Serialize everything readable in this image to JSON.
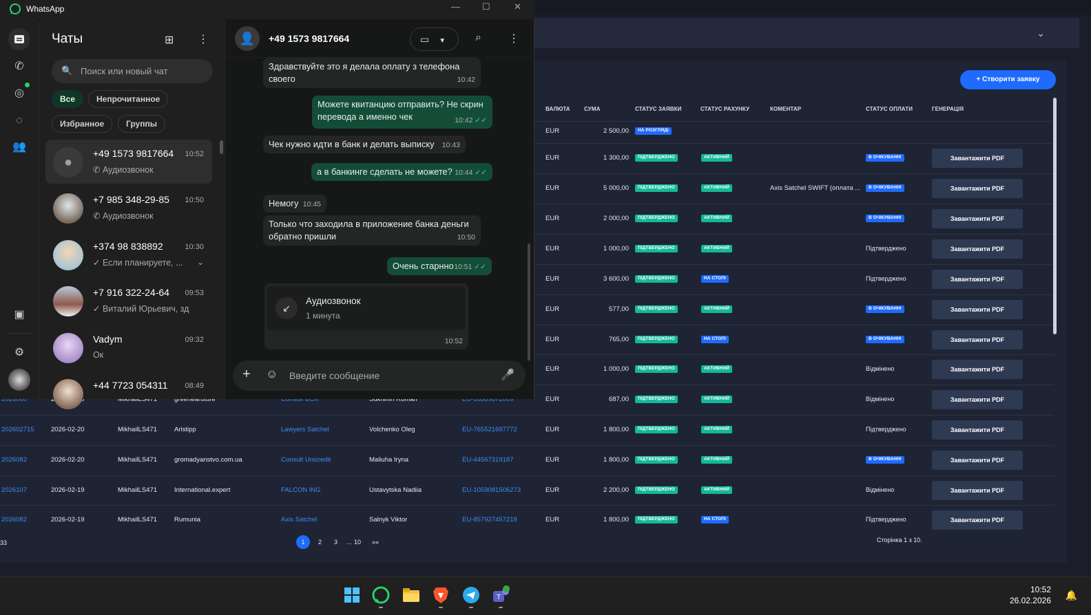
{
  "background_app": {
    "create_button": "+ Створити заявку",
    "columns": [
      "ВАЛЮТА",
      "СУМА",
      "СТАТУС ЗАЯВКИ",
      "СТАТУС РАХУНКУ",
      "КОМЕНТАР",
      "СТАТУС ОПЛАТИ",
      "ГЕНЕРАЦІЯ"
    ],
    "pdf_label": "Завантажити PDF",
    "rows": [
      {
        "id": "",
        "date": "",
        "user": "",
        "site": "",
        "company": "",
        "client": "",
        "iban": "",
        "currency": "EUR",
        "sum": "2 500,00",
        "req_status": "НА РОЗГЛЯДІ",
        "req_color": "blue",
        "acc_status": "",
        "acc_color": "",
        "comment": "",
        "pay_status": "",
        "pay_badge": false,
        "pdf": false
      },
      {
        "id": "",
        "date": "",
        "user": "",
        "site": "",
        "company": "",
        "client": "",
        "iban": "",
        "currency": "EUR",
        "sum": "1 300,00",
        "req_status": "ПІДТВЕРДЖЕНО",
        "req_color": "green",
        "acc_status": "АКТИВНИЙ",
        "acc_color": "green",
        "comment": "",
        "pay_status": "В ОЧІКУВАННІ",
        "pay_badge": true,
        "pdf": true
      },
      {
        "id": "",
        "date": "",
        "user": "",
        "site": "",
        "company": "",
        "client": "",
        "iban": "",
        "currency": "EUR",
        "sum": "5 000,00",
        "req_status": "ПІДТВЕРДЖЕНО",
        "req_color": "green",
        "acc_status": "АКТИВНИЙ",
        "acc_color": "green",
        "comment": "Axis Satchel SWIFT (оплата ...",
        "pay_status": "В ОЧІКУВАННІ",
        "pay_badge": true,
        "pdf": true
      },
      {
        "id": "",
        "date": "",
        "user": "",
        "site": "",
        "company": "",
        "client": "",
        "iban": "",
        "currency": "EUR",
        "sum": "2 000,00",
        "req_status": "ПІДТВЕРДЖЕНО",
        "req_color": "green",
        "acc_status": "АКТИВНИЙ",
        "acc_color": "green",
        "comment": "",
        "pay_status": "В ОЧІКУВАННІ",
        "pay_badge": true,
        "pdf": true
      },
      {
        "id": "",
        "date": "",
        "user": "",
        "site": "",
        "company": "",
        "client": "",
        "iban": "",
        "currency": "EUR",
        "sum": "1 000,00",
        "req_status": "ПІДТВЕРДЖЕНО",
        "req_color": "green",
        "acc_status": "АКТИВНИЙ",
        "acc_color": "green",
        "comment": "",
        "pay_status": "Підтверджено",
        "pay_badge": false,
        "pdf": true
      },
      {
        "id": "",
        "date": "",
        "user": "",
        "site": "",
        "company": "",
        "client": "",
        "iban": "",
        "currency": "EUR",
        "sum": "3 600,00",
        "req_status": "ПІДТВЕРДЖЕНО",
        "req_color": "green",
        "acc_status": "НА СТОПІ",
        "acc_color": "blue",
        "comment": "",
        "pay_status": "Підтверджено",
        "pay_badge": false,
        "pdf": true
      },
      {
        "id": "",
        "date": "",
        "user": "",
        "site": "",
        "company": "",
        "client": "",
        "iban": "",
        "currency": "EUR",
        "sum": "577,00",
        "req_status": "ПІДТВЕРДЖЕНО",
        "req_color": "green",
        "acc_status": "АКТИВНИЙ",
        "acc_color": "green",
        "comment": "",
        "pay_status": "В ОЧІКУВАННІ",
        "pay_badge": true,
        "pdf": true
      },
      {
        "id": "",
        "date": "",
        "user": "",
        "site": "",
        "company": "",
        "client": "",
        "iban": "",
        "currency": "EUR",
        "sum": "765,00",
        "req_status": "ПІДТВЕРДЖЕНО",
        "req_color": "green",
        "acc_status": "НА СТОПІ",
        "acc_color": "blue",
        "comment": "",
        "pay_status": "В ОЧІКУВАННІ",
        "pay_badge": true,
        "pdf": true
      },
      {
        "id": "",
        "date": "",
        "user": "",
        "site": "",
        "company": "",
        "client": "",
        "iban": "",
        "currency": "EUR",
        "sum": "1 000,00",
        "req_status": "ПІДТВЕРДЖЕНО",
        "req_color": "green",
        "acc_status": "АКТИВНИЙ",
        "acc_color": "green",
        "comment": "",
        "pay_status": "Відмінено",
        "pay_badge": false,
        "pdf": true
      },
      {
        "id": "2026080",
        "date": "2026-02-20",
        "user": "MikhailLS471",
        "site": "greenearuture",
        "company": "Consult BCR",
        "client": "Sukhinin Roman",
        "iban": "EU-16389872869",
        "currency": "EUR",
        "sum": "687,00",
        "req_status": "ПІДТВЕРДЖЕНО",
        "req_color": "green",
        "acc_status": "АКТИВНИЙ",
        "acc_color": "green",
        "comment": "",
        "pay_status": "Відмінено",
        "pay_badge": false,
        "pdf": true
      },
      {
        "id": "202602715",
        "date": "2026-02-20",
        "user": "MikhailLS471",
        "site": "Aristipp",
        "company": "Lawyers Satchel",
        "client": "Volchenko Oleg",
        "iban": "EU-765521697772",
        "currency": "EUR",
        "sum": "1 800,00",
        "req_status": "ПІДТВЕРДЖЕНО",
        "req_color": "green",
        "acc_status": "АКТИВНИЙ",
        "acc_color": "green",
        "comment": "",
        "pay_status": "Підтверджено",
        "pay_badge": false,
        "pdf": true
      },
      {
        "id": "2026082",
        "date": "2026-02-20",
        "user": "MikhailLS471",
        "site": "gromadyanstvo.com.ua",
        "company": "Consult Unicredit",
        "client": "Maliuha Iryna",
        "iban": "EU-44567319187",
        "currency": "EUR",
        "sum": "1 800,00",
        "req_status": "ПІДТВЕРДЖЕНО",
        "req_color": "green",
        "acc_status": "АКТИВНИЙ",
        "acc_color": "green",
        "comment": "",
        "pay_status": "В ОЧІКУВАННІ",
        "pay_badge": true,
        "pdf": true
      },
      {
        "id": "2026107",
        "date": "2026-02-19",
        "user": "MikhailLS471",
        "site": "International.expert",
        "company": "FALCON ING",
        "client": "Ustavytska Nadiia",
        "iban": "EU-1059081506273",
        "currency": "EUR",
        "sum": "2 200,00",
        "req_status": "ПІДТВЕРДЖЕНО",
        "req_color": "green",
        "acc_status": "АКТИВНИЙ",
        "acc_color": "green",
        "comment": "",
        "pay_status": "Відмінено",
        "pay_badge": false,
        "pdf": true
      },
      {
        "id": "2026082",
        "date": "2026-02-19",
        "user": "MikhailLS471",
        "site": "Rumunia",
        "company": "Axis Satchel",
        "client": "Salnyk Viktor",
        "iban": "EU-857927457219",
        "currency": "EUR",
        "sum": "1 800,00",
        "req_status": "ПІДТВЕРДЖЕНО",
        "req_color": "green",
        "acc_status": "НА СТОПІ",
        "acc_color": "blue",
        "comment": "",
        "pay_status": "Підтверджено",
        "pay_badge": false,
        "pdf": true
      }
    ],
    "total": "33",
    "pager": [
      "1",
      "2",
      "3",
      "...",
      "10",
      "»»"
    ],
    "page_info": "Сторінка 1 з 10."
  },
  "whatsapp": {
    "window_title": "WhatsApp",
    "chats_title": "Чаты",
    "search_placeholder": "Поиск или новый чат",
    "filters": [
      "Все",
      "Непрочитанное",
      "Избранное",
      "Группы"
    ],
    "chats": [
      {
        "name": "+49 1573 9817664",
        "time": "10:52",
        "msg": "Аудиозвонок",
        "icon": "call-icon",
        "active": true,
        "avatar": "default"
      },
      {
        "name": "+7 985 348-29-85",
        "time": "10:50",
        "msg": "Аудиозвонок",
        "icon": "call-icon",
        "active": false,
        "avatar": "photo"
      },
      {
        "name": "+374 98 838892",
        "time": "10:30",
        "msg": "✓ Если планируете, ...",
        "icon": "",
        "active": false,
        "avatar": "photo"
      },
      {
        "name": "+7 916 322-24-64",
        "time": "09:53",
        "msg": "✓ Виталий Юрьевич, зд...",
        "icon": "",
        "active": false,
        "avatar": "photo"
      },
      {
        "name": "Vadym",
        "time": "09:32",
        "msg": "Ок",
        "icon": "",
        "active": false,
        "avatar": "photo"
      },
      {
        "name": "+44 7723 054311",
        "time": "08:49",
        "msg": "",
        "icon": "",
        "active": false,
        "avatar": "photo"
      }
    ],
    "conversation": {
      "contact": "+49 1573 9817664",
      "messages": [
        {
          "dir": "in",
          "text": "Здравствуйте это я делала оплату з телефона своего",
          "time": "10:42"
        },
        {
          "dir": "out",
          "text": "Можете квитанцию отправить? Не скрин перевода а именно чек",
          "time": "10:42"
        },
        {
          "dir": "in",
          "text": "Чек нужно идти в банк и делать выписку",
          "time": "10:43"
        },
        {
          "dir": "out",
          "text": "а в банкинге сделать не можете?",
          "time": "10:44"
        },
        {
          "dir": "in",
          "text": "Немогу",
          "time": "10:45"
        },
        {
          "dir": "in",
          "text": "Только что заходила в приложение банка деньги обратно пришли",
          "time": "10:50"
        },
        {
          "dir": "out",
          "text": "Очень старнно",
          "time": "10:51"
        }
      ],
      "call": {
        "title": "Аудиозвонок",
        "duration": "1 минута",
        "time": "10:52"
      },
      "composer_placeholder": "Введите сообщение"
    }
  },
  "taskbar": {
    "time": "10:52",
    "date": "26.02.2026",
    "apps": [
      "windows-start",
      "whatsapp",
      "file-explorer",
      "brave",
      "telegram",
      "teams"
    ]
  }
}
